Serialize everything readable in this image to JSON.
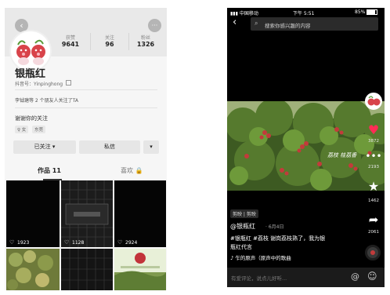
{
  "profile": {
    "back_glyph": "‹",
    "more_glyph": "···",
    "stats": [
      {
        "label": "获赞",
        "value": "9641"
      },
      {
        "label": "关注",
        "value": "96"
      },
      {
        "label": "粉丝",
        "value": "1326"
      }
    ],
    "name": "银瓶红",
    "douyin_id": "抖音号：Yinpinghong",
    "followed_by": "李钺瑭等 2 个朋友人关注了TA",
    "signature": "谢谢你的关注",
    "tags": [
      "♀ 女",
      "东莞"
    ],
    "follow_button": "已关注 ▾",
    "message_button": "私信",
    "dropdown_button": "▾",
    "tabs": [
      {
        "label": "作品 11"
      },
      {
        "label": "喜欢 🔒"
      }
    ],
    "tiles": [
      {
        "count": "1923"
      },
      {
        "count": "1128"
      },
      {
        "count": "2924"
      }
    ]
  },
  "video": {
    "status": {
      "carrier": "中国移动",
      "time": "下午 5:51",
      "battery": "85%"
    },
    "search_placeholder": "搜索你感兴趣的内容",
    "watermark": "荔枝 桂荔香",
    "side": {
      "like_count": "3872",
      "comment_count": "2193",
      "favorite_count": "1462",
      "share_count": "2061"
    },
    "edit_tag": "剪映 | 剪映",
    "author": "@银瓶红",
    "date": "· 6月4日",
    "caption_line1": "#银瓶红 #荔枝 谢岗荔枝熟了，我为银",
    "caption_line2": "瓶红代言",
    "music": "♪ 乍的原声（原声中的歌曲",
    "comment_placeholder": "有爱评论，说点儿好听..."
  },
  "colors": {
    "video_bg": "#000000",
    "like_red": "#ff2c55",
    "tree_green": "#4c7a2a",
    "lychee_red": "#c23b3b"
  }
}
